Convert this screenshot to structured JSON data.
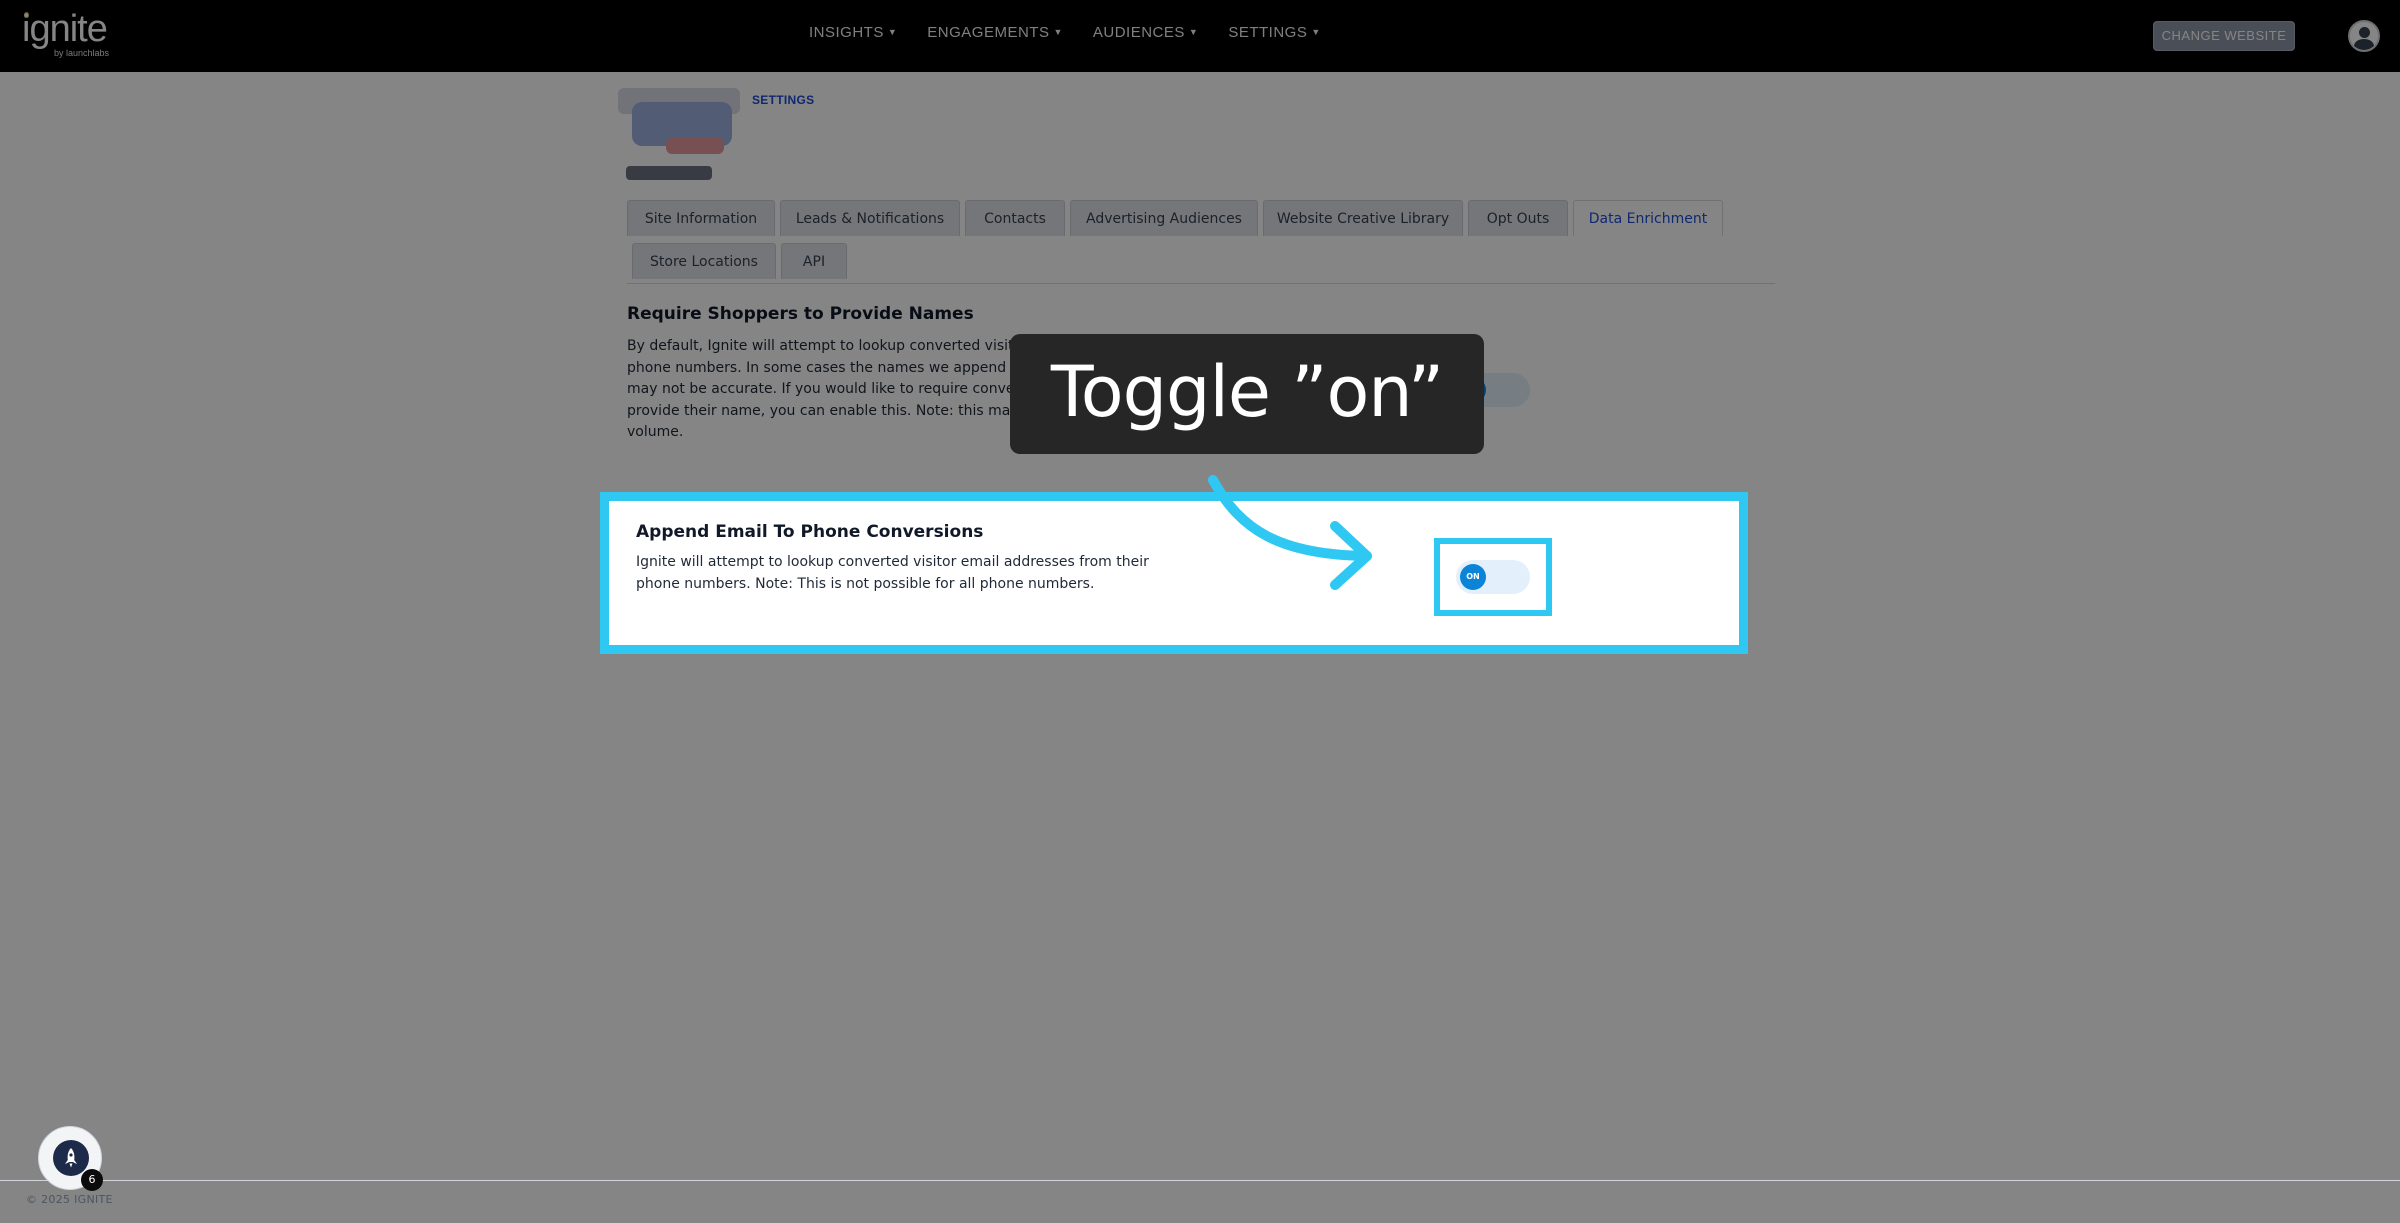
{
  "header": {
    "logo_text": "ignite",
    "logo_subtext": "by launchlabs",
    "nav": [
      {
        "label": "INSIGHTS"
      },
      {
        "label": "ENGAGEMENTS"
      },
      {
        "label": "AUDIENCES"
      },
      {
        "label": "SETTINGS"
      }
    ],
    "change_website_label": "CHANGE WEBSITE"
  },
  "breadcrumb": "SETTINGS",
  "tabs": [
    {
      "label": "Site Information",
      "active": false
    },
    {
      "label": "Leads & Notifications",
      "active": false
    },
    {
      "label": "Contacts",
      "active": false
    },
    {
      "label": "Advertising Audiences",
      "active": false
    },
    {
      "label": "Website Creative Library",
      "active": false
    },
    {
      "label": "Opt Outs",
      "active": false
    },
    {
      "label": "Data Enrichment",
      "active": true
    },
    {
      "label": "Store Locations",
      "active": false
    },
    {
      "label": "API",
      "active": false
    }
  ],
  "sections": {
    "require_names": {
      "title": "Require Shoppers to Provide Names",
      "description": "By default, Ignite will attempt to lookup converted visitor names from their phone numbers. In some cases the names we append to phone numbers may not be accurate. If you would like to require converted visitors to provide their name, you can enable this. Note: this may decrease lead volume.",
      "toggle_label": "ON",
      "toggle_on": true
    },
    "append_email": {
      "title": "Append Email To Phone Conversions",
      "description": "Ignite will attempt to lookup converted visitor email addresses from their phone numbers. Note: This is not possible for all phone numbers.",
      "toggle_label": "ON",
      "toggle_on": true
    }
  },
  "callout": {
    "text": "Toggle ”on”"
  },
  "footer": {
    "copyright": "© 2025 IGNITE",
    "help_badge_count": "6"
  },
  "colors": {
    "highlight": "#2ec8f3",
    "toggle_knob": "#0b84d8",
    "link": "#1d4ed8",
    "topbar": "#000000"
  },
  "icons": [
    "caret-down-icon",
    "user-avatar-icon",
    "rocket-icon",
    "arrow-icon"
  ]
}
